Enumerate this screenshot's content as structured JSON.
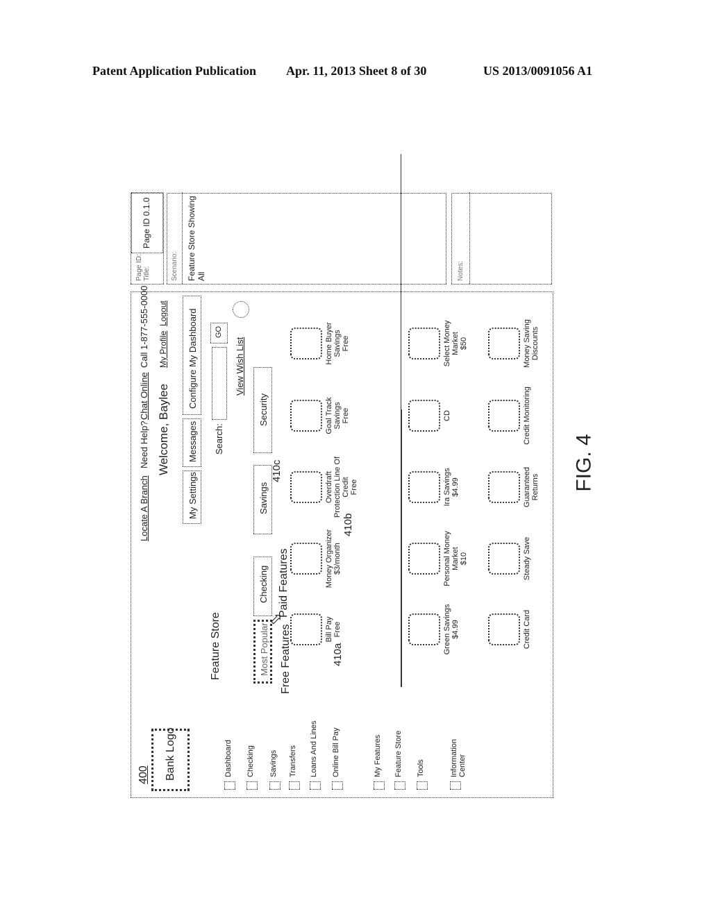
{
  "header": {
    "left": "Patent Application Publication",
    "center": "Apr. 11, 2013  Sheet 8 of 30",
    "right": "US 2013/0091056 A1"
  },
  "figure_label": "FIG. 4",
  "side_panel": {
    "page_id_label": "Page ID:",
    "title_label": "Title:",
    "page_id_value": "Page ID 0.1.0",
    "scenario_label": "Scenario:",
    "scenario_value": "Feature Store Showing All",
    "notes_label": "Notes:"
  },
  "screen": {
    "ref_number": "400",
    "logo": "Bank Logo",
    "top_links": [
      "Locate A Branch",
      "Need Help?",
      "Chat Online",
      "Call 1-877-555-0000"
    ],
    "welcome": "Welcome, Baylee",
    "profile_link": "My Profile",
    "logout_link": "Logout",
    "tabs": [
      "My Settings",
      "Messages",
      "Configure My Dashboard"
    ],
    "search_label": "Search:",
    "search_value": "",
    "go_button": "GO",
    "wish_list_link": "View Wish List",
    "page_title": "Feature Store",
    "categories": [
      "Most Popular",
      "Checking",
      "Savings",
      "Security"
    ],
    "selected_category": "Most Popular",
    "free_heading": "Free Features",
    "paid_heading": "Paid Features",
    "nav_items": [
      "Dashboard",
      "Checking",
      "Savings",
      "Transfers",
      "Loans And Lines",
      "Online Bill Pay",
      "My Features",
      "Feature Store",
      "Tools",
      "Information Center"
    ],
    "row1": [
      {
        "name": "Bill Pay",
        "price": "Free",
        "ref": "410a"
      },
      {
        "name": "Money Organizer",
        "price": "$3/month",
        "ref": "410b"
      },
      {
        "name": "Overdraft Protection Line Of Credit",
        "price": "Free",
        "ref": "410c"
      },
      {
        "name": "Goal Track Savings",
        "price": "Free"
      },
      {
        "name": "Home Buyer Savings",
        "price": "Free"
      }
    ],
    "row2": [
      {
        "name": "Green Savings",
        "price": "$4.99"
      },
      {
        "name": "Personal Money Market",
        "price": "$10"
      },
      {
        "name": "Ira Savings",
        "price": "$4.99"
      },
      {
        "name": "CD",
        "price": ""
      },
      {
        "name": "Select Money Market",
        "price": "$50"
      }
    ],
    "row3": [
      {
        "name": "Credit Card",
        "price": ""
      },
      {
        "name": "Steady Save",
        "price": ""
      },
      {
        "name": "Guaranteed Returns",
        "price": ""
      },
      {
        "name": "Credit Monitoring",
        "price": ""
      },
      {
        "name": "Money Saving Discounts",
        "price": ""
      }
    ]
  }
}
